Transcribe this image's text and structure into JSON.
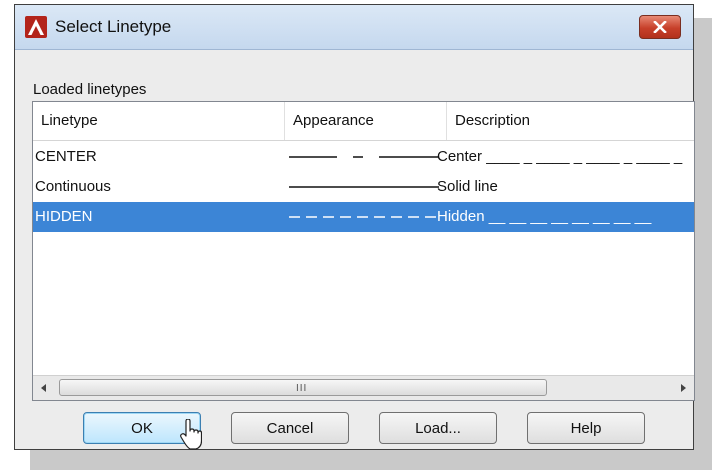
{
  "window": {
    "title": "Select Linetype",
    "close_icon": "close-icon"
  },
  "section": {
    "label": "Loaded linetypes"
  },
  "table": {
    "columns": [
      "Linetype",
      "Appearance",
      "Description"
    ],
    "rows": [
      {
        "name": "CENTER",
        "description": "Center ____ _ ____ _ ____ _ ____ _",
        "pattern": "center"
      },
      {
        "name": "Continuous",
        "description": "Solid line",
        "pattern": "solid"
      },
      {
        "name": "HIDDEN",
        "description": "Hidden __ __ __ __ __ __ __ __",
        "pattern": "hidden",
        "selected": true
      }
    ]
  },
  "scrollbar": {
    "grip": "III"
  },
  "buttons": {
    "ok": "OK",
    "cancel": "Cancel",
    "load": "Load...",
    "help": "Help"
  },
  "colors": {
    "selection": "#3c85d6",
    "close": "#c7402a",
    "title_bar": "#c5d8ee"
  }
}
